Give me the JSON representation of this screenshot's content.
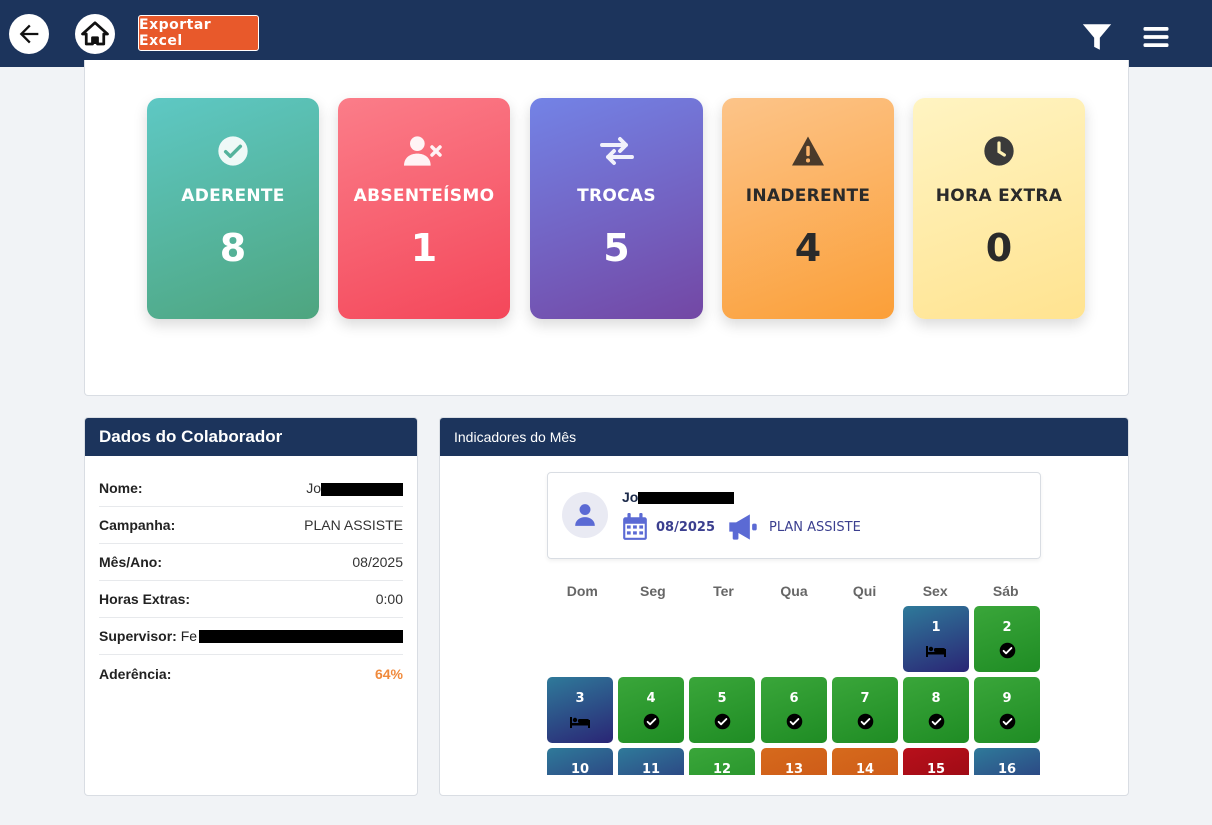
{
  "header": {
    "export_label": "Exportar Excel"
  },
  "cards": [
    {
      "label": "ADERENTE",
      "value": "8",
      "icon": "check-circle-icon"
    },
    {
      "label": "ABSENTEÍSMO",
      "value": "1",
      "icon": "user-x-icon"
    },
    {
      "label": "TROCAS",
      "value": "5",
      "icon": "swap-arrows-icon"
    },
    {
      "label": "INADERENTE",
      "value": "4",
      "icon": "warning-icon"
    },
    {
      "label": "HORA EXTRA",
      "value": "0",
      "icon": "clock-icon"
    }
  ],
  "collaborator": {
    "title": "Dados do Colaborador",
    "rows": [
      {
        "key": "Nome:",
        "value": "Jo"
      },
      {
        "key": "Campanha:",
        "value": "PLAN ASSISTE"
      },
      {
        "key": "Mês/Ano:",
        "value": "08/2025"
      },
      {
        "key": "Horas Extras:",
        "value": "0:00"
      },
      {
        "key": "Supervisor:",
        "value": "Fe"
      },
      {
        "key": "Aderência:",
        "value": "64%"
      }
    ]
  },
  "indicators": {
    "title": "Indicadores do Mês",
    "employee_name": "Jo",
    "month": "08/2025",
    "campaign": "PLAN ASSISTE",
    "weekdays": [
      "Dom",
      "Seg",
      "Ter",
      "Qua",
      "Qui",
      "Sex",
      "Sáb"
    ],
    "days": [
      {
        "day": "1",
        "status": "folga",
        "icon": "bed-icon",
        "color": "#2a2575"
      },
      {
        "day": "2",
        "status": "aderente",
        "icon": "check-circle-icon",
        "color": "#1f8c24"
      },
      {
        "day": "3",
        "status": "folga",
        "icon": "bed-icon",
        "color": "#2a2575"
      },
      {
        "day": "4",
        "status": "aderente",
        "icon": "check-circle-icon",
        "color": "#1f8c24"
      },
      {
        "day": "5",
        "status": "aderente",
        "icon": "check-circle-icon",
        "color": "#1f8c24"
      },
      {
        "day": "6",
        "status": "aderente",
        "icon": "check-circle-icon",
        "color": "#1f8c24"
      },
      {
        "day": "7",
        "status": "aderente",
        "icon": "check-circle-icon",
        "color": "#1f8c24"
      },
      {
        "day": "8",
        "status": "aderente",
        "icon": "check-circle-icon",
        "color": "#1f8c24"
      },
      {
        "day": "9",
        "status": "aderente",
        "icon": "check-circle-icon",
        "color": "#1f8c24"
      },
      {
        "day": "10",
        "status": "folga",
        "icon": "",
        "color": "#2a2575"
      },
      {
        "day": "11",
        "status": "folga",
        "icon": "",
        "color": "#2a2575"
      },
      {
        "day": "12",
        "status": "aderente",
        "icon": "",
        "color": "#1f8c24"
      },
      {
        "day": "13",
        "status": "inaderente",
        "icon": "",
        "color": "#c85216"
      },
      {
        "day": "14",
        "status": "inaderente",
        "icon": "",
        "color": "#c85216"
      },
      {
        "day": "15",
        "status": "absenteismo",
        "icon": "",
        "color": "#8e0711"
      },
      {
        "day": "16",
        "status": "folga",
        "icon": "",
        "color": "#2a2575"
      }
    ]
  }
}
